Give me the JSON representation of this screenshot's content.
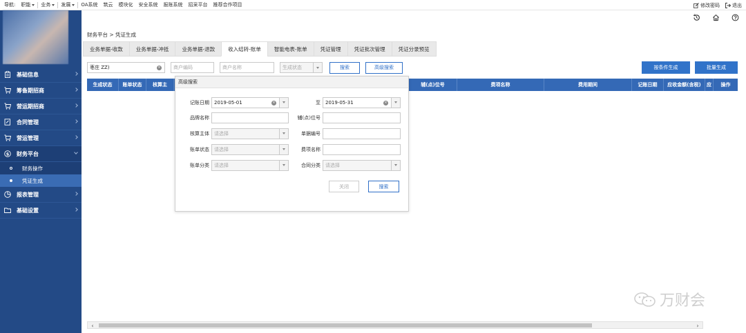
{
  "topnav": {
    "items": [
      "导航:",
      "职能",
      "业务",
      "发展",
      "OA系统",
      "筑云",
      "模块化",
      "安全系统",
      "报账系统",
      "招采平台",
      "推荐合作项目"
    ],
    "change_password": "修改密码",
    "logout": "退出"
  },
  "sidebar": {
    "items": [
      {
        "label": "基础信息"
      },
      {
        "label": "筹备期招商"
      },
      {
        "label": "营运期招商"
      },
      {
        "label": "合同管理"
      },
      {
        "label": "营运管理"
      },
      {
        "label": "财务平台"
      },
      {
        "label": "报表管理"
      },
      {
        "label": "基础设置"
      }
    ],
    "sub_items": [
      {
        "label": "财务操作"
      },
      {
        "label": "凭证生成"
      }
    ]
  },
  "breadcrumb": "财务平台 > 凭证生成",
  "tabs": [
    "业务单据-收款",
    "业务单据-冲抵",
    "业务单据-退款",
    "收入结转-账单",
    "智能电表-账单",
    "凭证管理",
    "凭证批次管理",
    "凭证分录预览"
  ],
  "filters": {
    "project_value": "枣庄        ZZ)",
    "merchant_code_placeholder": "商户编码",
    "merchant_name_placeholder": "商户名称",
    "status_placeholder": "生成状态",
    "search_label": "搜索",
    "advanced_label": "高级搜索",
    "generate_by_condition": "按条件生成",
    "batch_generate": "批量生成"
  },
  "table": {
    "columns": [
      "生成状态",
      "账单状态",
      "核算主",
      "",
      "",
      "",
      "",
      "",
      "辅(点)位号",
      "费项名称",
      "费用期间",
      "记账日期",
      "应收金额(含税)",
      "应",
      "操作"
    ]
  },
  "advanced_search": {
    "title": "高级搜索",
    "date_label": "记账日期",
    "date_from": "2019-05-01",
    "to_label": "至",
    "date_to": "2019-05-31",
    "brand_label": "品牌名称",
    "position_label": "辅(点)位号",
    "entity_label": "核算主体",
    "entity_placeholder": "请选择",
    "doc_no_label": "单据编号",
    "bill_status_label": "账单状态",
    "bill_status_placeholder": "请选择",
    "fee_name_label": "费项名称",
    "bill_category_label": "账单分类",
    "bill_category_placeholder": "请选择",
    "contract_category_label": "合同分类",
    "contract_category_placeholder": "请选择",
    "close_label": "关闭",
    "search_label": "搜索"
  },
  "watermark": "万财会"
}
